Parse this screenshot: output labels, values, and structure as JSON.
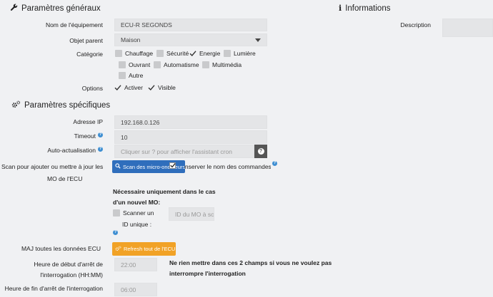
{
  "general": {
    "title": "Paramètres généraux",
    "name_label": "Nom de l'équipement",
    "name_value": "ECU-R SEGONDS",
    "parent_label": "Objet parent",
    "parent_value": "Maison",
    "category_label": "Catégorie",
    "categories": [
      {
        "label": "Chauffage",
        "checked": false
      },
      {
        "label": "Sécurité",
        "checked": false
      },
      {
        "label": "Energie",
        "checked": true
      },
      {
        "label": "Lumière",
        "checked": false
      },
      {
        "label": "Ouvrant",
        "checked": false
      },
      {
        "label": "Automatisme",
        "checked": false
      },
      {
        "label": "Multimédia",
        "checked": false
      },
      {
        "label": "Autre",
        "checked": false
      }
    ],
    "options_label": "Options",
    "options": [
      {
        "label": "Activer",
        "checked": true
      },
      {
        "label": "Visible",
        "checked": true
      }
    ]
  },
  "info": {
    "title": "Informations",
    "description_label": "Description",
    "description_value": ""
  },
  "specific": {
    "title": "Paramètres spécifiques",
    "ip_label": "Adresse IP",
    "ip_value": "192.168.0.126",
    "timeout_label": "Timeout",
    "timeout_value": "10",
    "autorefresh_label": "Auto-actualisation",
    "autorefresh_placeholder": "Cliquer sur ? pour afficher l'assistant cron",
    "autorefresh_help_glyph": "?",
    "scan_label_line1": "Scan pour ajouter ou mettre à jour les",
    "scan_label_line2": "MO de l'ECU",
    "scan_button": "Scan des micro-onduleurs",
    "keep_names_label": "Conserver le nom des commandes",
    "new_mo_note_line1": "Nécessaire uniquement dans le cas",
    "new_mo_note_line2": "d'un nouvel MO:",
    "scan_unique_line1": "Scanner un",
    "scan_unique_line2": "ID unique :",
    "mo_id_placeholder": "ID du MO à scanner",
    "maj_label": "MAJ toutes les données ECU",
    "refresh_button": "Refresh tout de l'ECU",
    "start_label_line1": "Heure de début d'arrêt de",
    "start_label_line2": "l'interrogation (HH:MM)",
    "start_value": "22:00",
    "end_label": "Heure de fin d'arrêt de l'interrogation",
    "end_value": "06:00",
    "hint_line1": "Ne rien mettre dans ces 2 champs si vous ne voulez pas",
    "hint_line2": "interrompre l'interrogation"
  },
  "colors": {
    "blue_button": "#2f6ebc",
    "orange_button": "#f1a226",
    "help_icon": "#3f8fd2",
    "dark_button": "#555555"
  }
}
